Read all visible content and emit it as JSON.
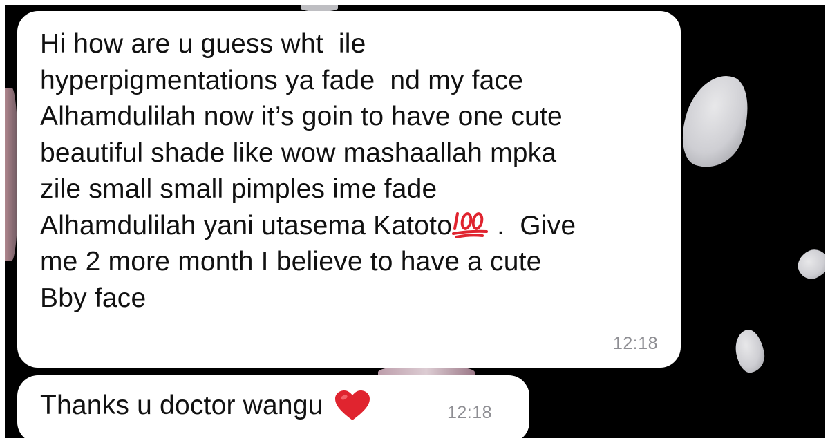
{
  "messages": [
    {
      "text_before_emoji": "Hi how are u guess wht  ile\nhyperpigmentations ya fade  nd my face\nAlhamdulilah now it’s goin to have one cute\nbeautiful shade like wow mashaallah mpka\nzile small small pimples ime fade\nAlhamdulilah yani utasema Katoto",
      "emoji": "hundred-points-icon",
      "text_after_emoji": " .  Give\nme 2 more month I believe to have a cute\nBby face",
      "time": "12:18"
    },
    {
      "text": "Thanks u doctor wangu",
      "emoji": "red-heart-icon",
      "time": "12:18"
    }
  ],
  "colors": {
    "background": "#000000",
    "bubble": "#ffffff",
    "timestamp": "#8e8e93",
    "heart": "#e0242f",
    "hundred": "#e0242f"
  }
}
